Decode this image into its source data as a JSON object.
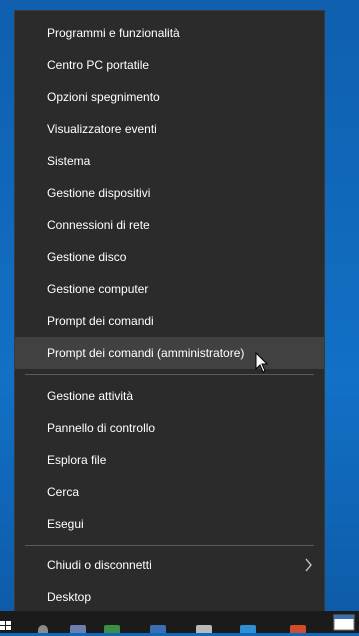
{
  "menu": {
    "group1": [
      {
        "label": "Programmi e funzionalità"
      },
      {
        "label": "Centro PC portatile"
      },
      {
        "label": "Opzioni spegnimento"
      },
      {
        "label": "Visualizzatore eventi"
      },
      {
        "label": "Sistema"
      },
      {
        "label": "Gestione dispositivi"
      },
      {
        "label": "Connessioni di rete"
      },
      {
        "label": "Gestione disco"
      },
      {
        "label": "Gestione computer"
      },
      {
        "label": "Prompt dei comandi"
      },
      {
        "label": "Prompt dei comandi (amministratore)"
      }
    ],
    "group2": [
      {
        "label": "Gestione attività"
      },
      {
        "label": "Pannello di controllo"
      },
      {
        "label": "Esplora file"
      },
      {
        "label": "Cerca"
      },
      {
        "label": "Esegui"
      }
    ],
    "group3": [
      {
        "label": "Chiudi o disconnetti",
        "submenu_icon": "chevron-right-icon"
      },
      {
        "label": "Desktop"
      }
    ],
    "hovered_item": "Prompt dei comandi (amministratore)"
  },
  "colors": {
    "menu_bg": "#2b2b2b",
    "hover_bg": "#414141",
    "desktop_bg": "#1167b8",
    "taskbar_bg": "#1b1b1b",
    "text": "#ffffff"
  },
  "icons": [
    "chevron-right-icon",
    "mouse-pointer-icon",
    "windows-logo-icon"
  ]
}
